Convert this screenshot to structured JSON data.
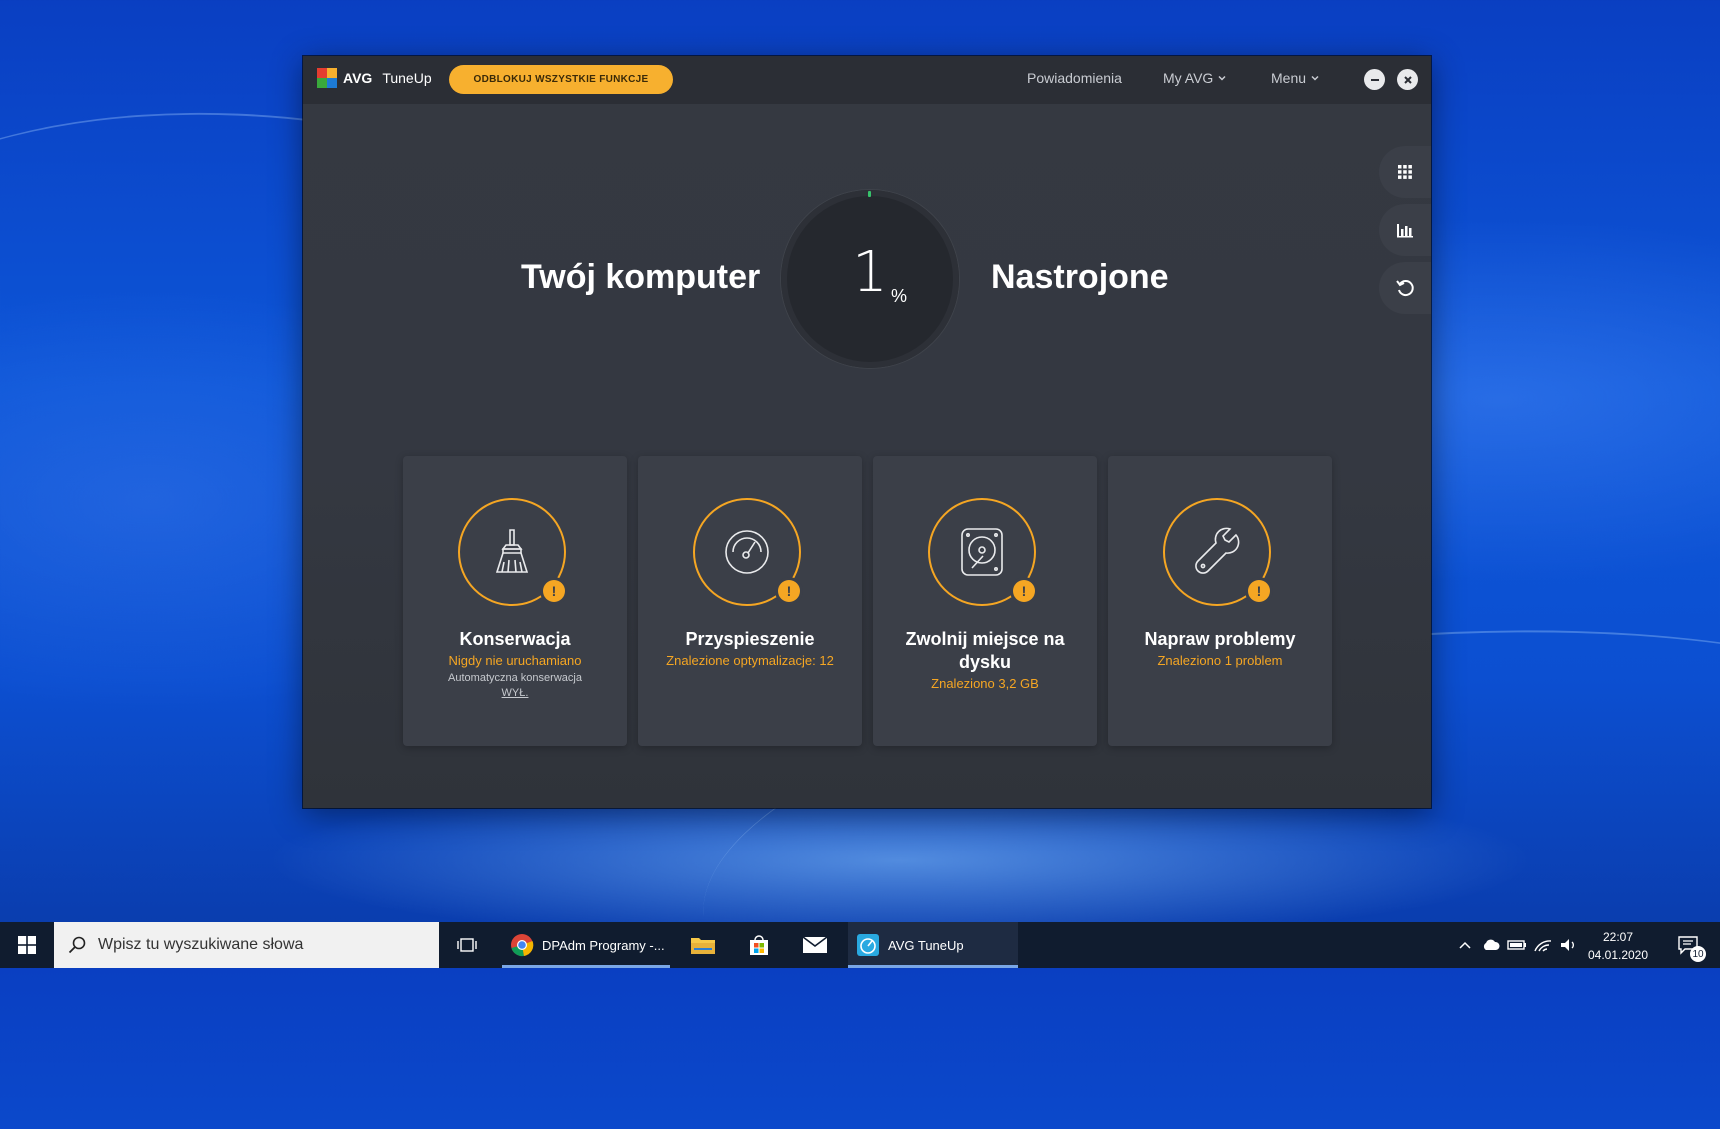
{
  "window": {
    "logo_brand": "AVG",
    "logo_product": "TuneUp",
    "unlock_label": "ODBLOKUJ WSZYSTKIE FUNKCJE",
    "nav": {
      "notifications": "Powiadomienia",
      "my_avg": "My AVG",
      "menu": "Menu"
    },
    "side_tools": [
      "grid-icon",
      "bar-chart-icon",
      "undo-icon"
    ]
  },
  "hero": {
    "left_text": "Twój komputer",
    "right_text": "Nastrojone",
    "percent_value": "1",
    "percent_unit": "%"
  },
  "cards": [
    {
      "icon": "broom-icon",
      "title": "Konserwacja",
      "subtitle": "Nigdy nie uruchamiano",
      "note": "Automatyczna konserwacja",
      "link": "WYŁ."
    },
    {
      "icon": "speedometer-icon",
      "title": "Przyspieszenie",
      "subtitle": "Znalezione optymalizacje: 12"
    },
    {
      "icon": "hard-disk-icon",
      "title": "Zwolnij miejsce na dysku",
      "subtitle": "Znaleziono 3,2 GB"
    },
    {
      "icon": "wrench-icon",
      "title": "Napraw problemy",
      "subtitle": "Znaleziono 1 problem"
    }
  ],
  "taskbar": {
    "search_placeholder": "Wpisz tu wyszukiwane słowa",
    "chrome_label": "DPAdm Programy -...",
    "avg_label": "AVG TuneUp",
    "time": "22:07",
    "date": "04.01.2020",
    "notification_count": "10"
  },
  "colors": {
    "accent": "#f5a623",
    "window_bg": "#353941",
    "card_bg": "#3b3f48",
    "taskbar_bg": "#101c2f"
  }
}
